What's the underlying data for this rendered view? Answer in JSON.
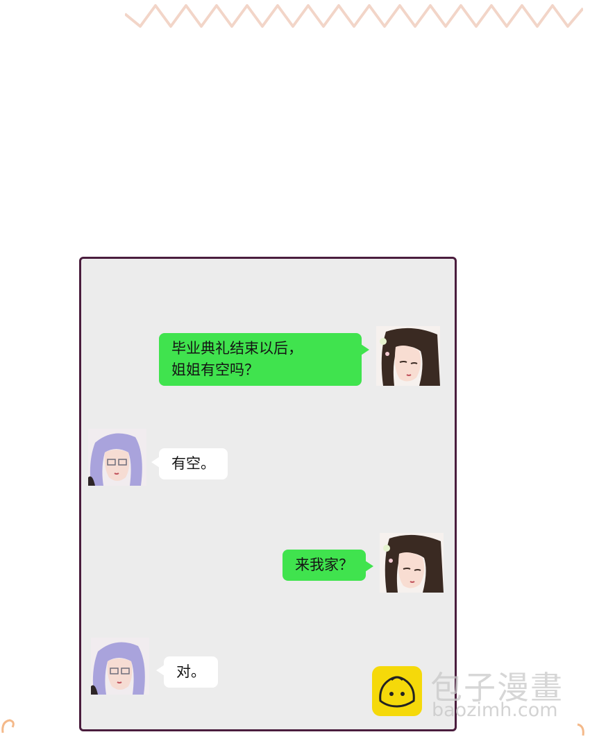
{
  "messages": [
    {
      "sender": "brown-haired girl",
      "side": "right",
      "bubble_color": "#40e34e",
      "lines": [
        "毕业典礼结束以后，",
        "姐姐有空吗？"
      ]
    },
    {
      "sender": "purple-haired woman",
      "side": "left",
      "bubble_color": "#ffffff",
      "lines": [
        "有空。"
      ]
    },
    {
      "sender": "brown-haired girl",
      "side": "right",
      "bubble_color": "#40e34e",
      "lines": [
        "来我家？"
      ]
    },
    {
      "sender": "purple-haired woman",
      "side": "left",
      "bubble_color": "#ffffff",
      "lines": [
        "对。"
      ]
    }
  ],
  "watermark": {
    "name": "包子漫畫",
    "url": "baozimh.com",
    "logo_color": "#f5d90a"
  },
  "colors": {
    "frame_border": "#4a1d3d",
    "chat_background": "#ececec",
    "zigzag": "#f2c9b8"
  }
}
